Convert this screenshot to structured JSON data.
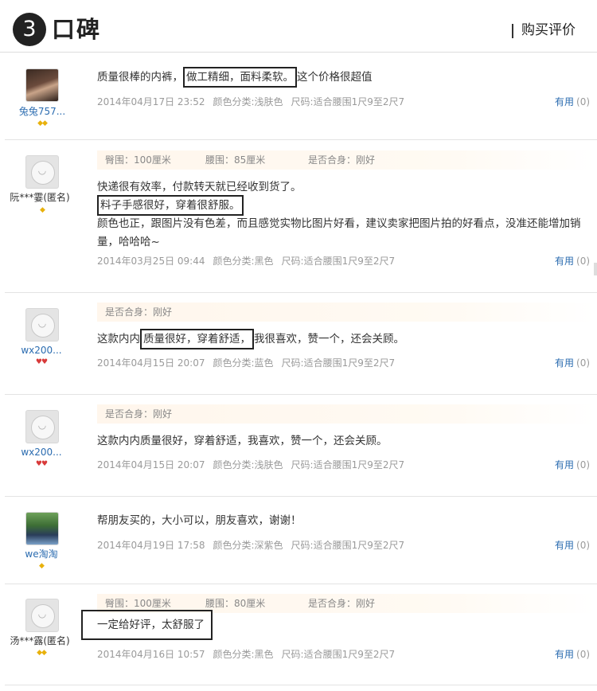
{
  "header": {
    "number": "3",
    "title": "口碑",
    "right_label": "购买评价"
  },
  "reviews": [
    {
      "user": "兔兔757...",
      "badge_type": "gold",
      "badge_count": 2,
      "attrs": [],
      "lines": [
        {
          "before": "质量很棒的内裤，",
          "boxed": "做工精细，面料柔软。",
          "after": "这个价格很超值"
        }
      ],
      "meta": {
        "date": "2014年04月17日 23:52",
        "color": "颜色分类:浅肤色",
        "size": "尺码:适合腰围1尺9至2尺7"
      },
      "useful_label": "有用",
      "useful_count": "(0)"
    },
    {
      "user": "阮***霎(匿名)",
      "badge_type": "gold",
      "badge_count": 1,
      "attrs": [
        "臀围：100厘米",
        "腰围：85厘米",
        "是否合身：刚好"
      ],
      "lines": [
        {
          "before": "快递很有效率，付款转天就已经收到货了。",
          "boxed": "",
          "after": ""
        },
        {
          "before": "",
          "boxed": "料子手感很好，穿着很舒服。",
          "after": ""
        },
        {
          "before": "颜色也正，跟图片没有色差，而且感觉实物比图片好看，建议卖家把图片拍的好看点，没准还能增加销",
          "boxed": "",
          "after": ""
        },
        {
          "before": "量，哈哈哈~",
          "boxed": "",
          "after": ""
        }
      ],
      "meta": {
        "date": "2014年03月25日 09:44",
        "color": "颜色分类:黑色",
        "size": "尺码:适合腰围1尺9至2尺7"
      },
      "useful_label": "有用",
      "useful_count": "(0)"
    },
    {
      "user": "wx200...",
      "badge_type": "red",
      "badge_count": 2,
      "attrs": [
        "是否合身：刚好"
      ],
      "lines": [
        {
          "before": "这款内内",
          "boxed": "质量很好，穿着舒适，",
          "after": "我很喜欢，赞一个，还会关顾。"
        }
      ],
      "meta": {
        "date": "2014年04月15日 20:07",
        "color": "颜色分类:蓝色",
        "size": "尺码:适合腰围1尺9至2尺7"
      },
      "useful_label": "有用",
      "useful_count": "(0)"
    },
    {
      "user": "wx200...",
      "badge_type": "red",
      "badge_count": 2,
      "attrs": [
        "是否合身：刚好"
      ],
      "lines": [
        {
          "before": "这款内内质量很好，穿着舒适，我喜欢，赞一个，还会关顾。",
          "boxed": "",
          "after": ""
        }
      ],
      "meta": {
        "date": "2014年04月15日 20:07",
        "color": "颜色分类:浅肤色",
        "size": "尺码:适合腰围1尺9至2尺7"
      },
      "useful_label": "有用",
      "useful_count": "(0)"
    },
    {
      "user": "we淘淘",
      "badge_type": "gold",
      "badge_count": 1,
      "attrs": [],
      "lines": [
        {
          "before": "帮朋友买的，大小可以，朋友喜欢，谢谢！",
          "boxed": "",
          "after": ""
        }
      ],
      "meta": {
        "date": "2014年04月19日 17:58",
        "color": "颜色分类:深紫色",
        "size": "尺码:适合腰围1尺9至2尺7"
      },
      "useful_label": "有用",
      "useful_count": "(0)"
    },
    {
      "user": "汤***露(匿名)",
      "badge_type": "gold",
      "badge_count": 2,
      "attrs": [
        "臀围：100厘米",
        "腰围：80厘米",
        "是否合身：刚好"
      ],
      "lines": [
        {
          "before": "",
          "boxed": "一定给好评，太舒服了",
          "after": ""
        }
      ],
      "meta": {
        "date": "2014年04月16日 10:57",
        "color": "颜色分类:黑色",
        "size": "尺码:适合腰围1尺9至2尺7"
      },
      "useful_label": "有用",
      "useful_count": "(0)"
    }
  ]
}
